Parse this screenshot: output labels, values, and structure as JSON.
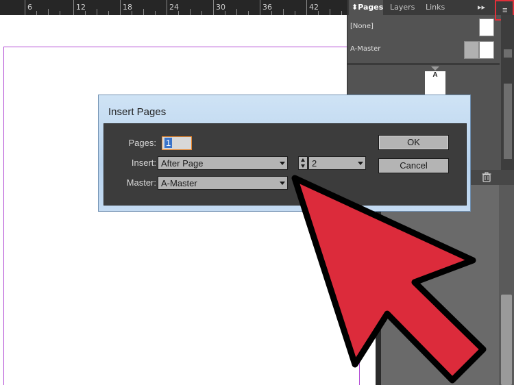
{
  "ruler": {
    "numbers": [
      "6",
      "12",
      "18",
      "24",
      "30",
      "36",
      "42"
    ]
  },
  "panel": {
    "tabs": [
      "Pages",
      "Layers",
      "Links"
    ],
    "masters": [
      "[None]",
      "A-Master"
    ],
    "page_label": "A"
  },
  "dialog": {
    "title": "Insert Pages",
    "pages_label": "Pages:",
    "pages_value": "1",
    "insert_label": "Insert:",
    "insert_value": "After Page",
    "page_number": "2",
    "master_label": "Master:",
    "master_value": "A-Master",
    "ok_label": "OK",
    "cancel_label": "Cancel"
  },
  "colors": {
    "highlight": "#e0303a",
    "arrow": "#dc2b3b",
    "selection": "#3a73c9"
  },
  "icons": [
    "panel-menu-icon",
    "expand-icon",
    "trash-icon",
    "chevron-down-icon",
    "stepper-icon",
    "pointer-arrow-icon"
  ]
}
